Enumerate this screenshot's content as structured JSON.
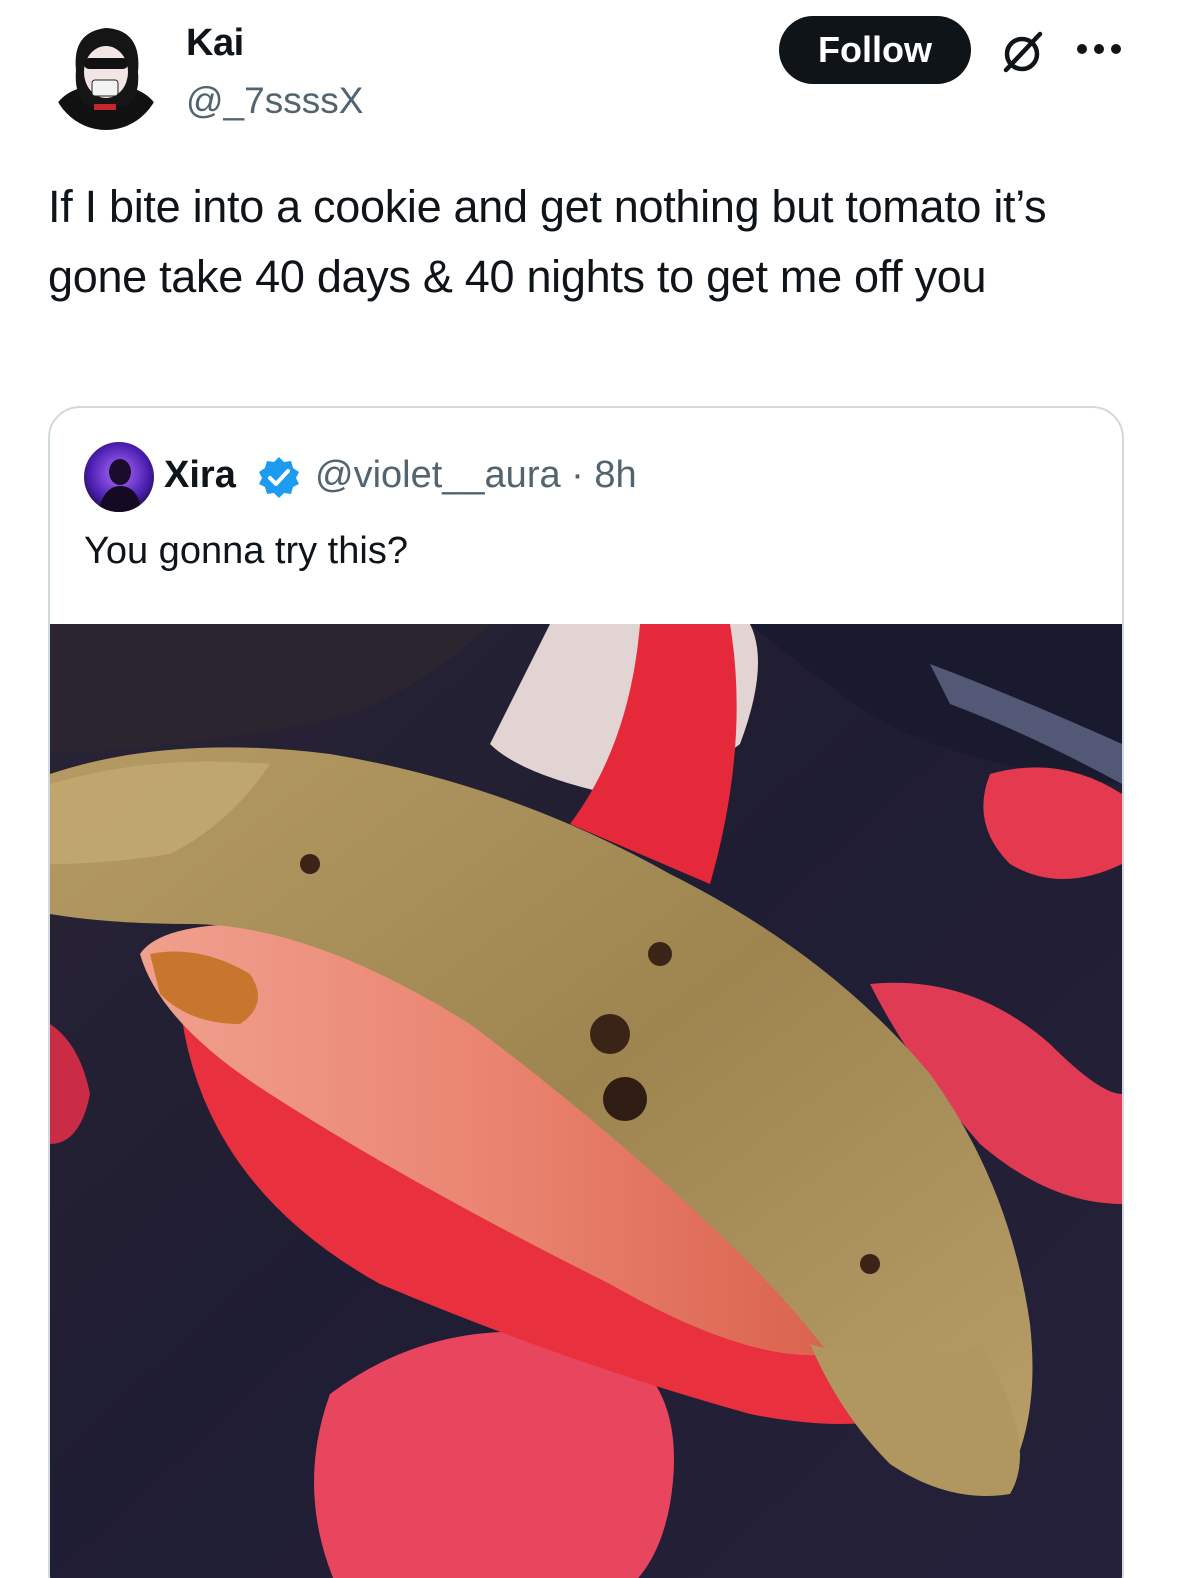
{
  "post": {
    "display_name": "Kai",
    "handle": "@_7ssssX",
    "follow_label": "Follow",
    "text": "If I bite into a cookie and get nothing but tomato it’s gone take 40 days & 40 nights to get me off you"
  },
  "quoted": {
    "display_name": "Xira",
    "handle_time": "@violet__aura · 8h",
    "text": "You gonna try this?"
  },
  "icons": {
    "grok": "grok-icon",
    "more": "more-icon",
    "verified": "verified-badge-icon"
  },
  "colors": {
    "follow_bg": "#0f1419",
    "verified": "#1d9bf0",
    "muted_text": "#536471",
    "card_border": "#cfd9de"
  }
}
